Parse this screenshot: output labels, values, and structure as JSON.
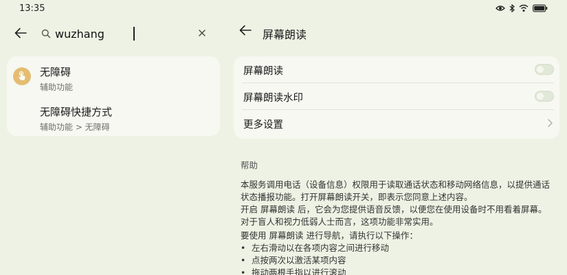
{
  "status_bar": {
    "time": "13:35",
    "icons": [
      "eye-icon",
      "bluetooth-icon",
      "wifi-icon",
      "battery-icon"
    ]
  },
  "search": {
    "value": "wuzhang",
    "icons": [
      "back-arrow-icon",
      "search-icon",
      "clear-icon"
    ]
  },
  "results": [
    {
      "title": "无障碍",
      "subtitle": "辅助功能",
      "icon": "hand-tap-icon"
    },
    {
      "title": "无障碍快捷方式",
      "subtitle": "辅助功能 > 无障碍"
    }
  ],
  "detail": {
    "title": "屏幕朗读",
    "settings": [
      {
        "label": "屏幕朗读",
        "control": "toggle",
        "on": false
      },
      {
        "label": "屏幕朗读水印",
        "control": "toggle",
        "on": false
      },
      {
        "label": "更多设置",
        "control": "chevron-right-icon"
      }
    ],
    "help": {
      "title": "帮助",
      "paragraphs": [
        "本服务调用电话（设备信息）权限用于读取通话状态和移动网络信息，以提供通话状态播报功能。打开屏幕朗读开关，即表示您同意上述内容。",
        "开启 屏幕朗读 后，它会为您提供语音反馈，以便您在使用设备时不用看着屏幕。对于盲人和视力低弱人士而言，这项功能非常实用。",
        "要使用 屏幕朗读 进行导航，请执行以下操作："
      ],
      "bullet_char": "•",
      "bullets": [
        "左右滑动以在各项内容之间进行移动",
        "点按两次以激活某项内容",
        "拖动两根手指以进行滚动"
      ]
    }
  },
  "colors": {
    "background": "#eef2e4",
    "card": "#f6f8f1",
    "avatar": "#e4bd72"
  }
}
